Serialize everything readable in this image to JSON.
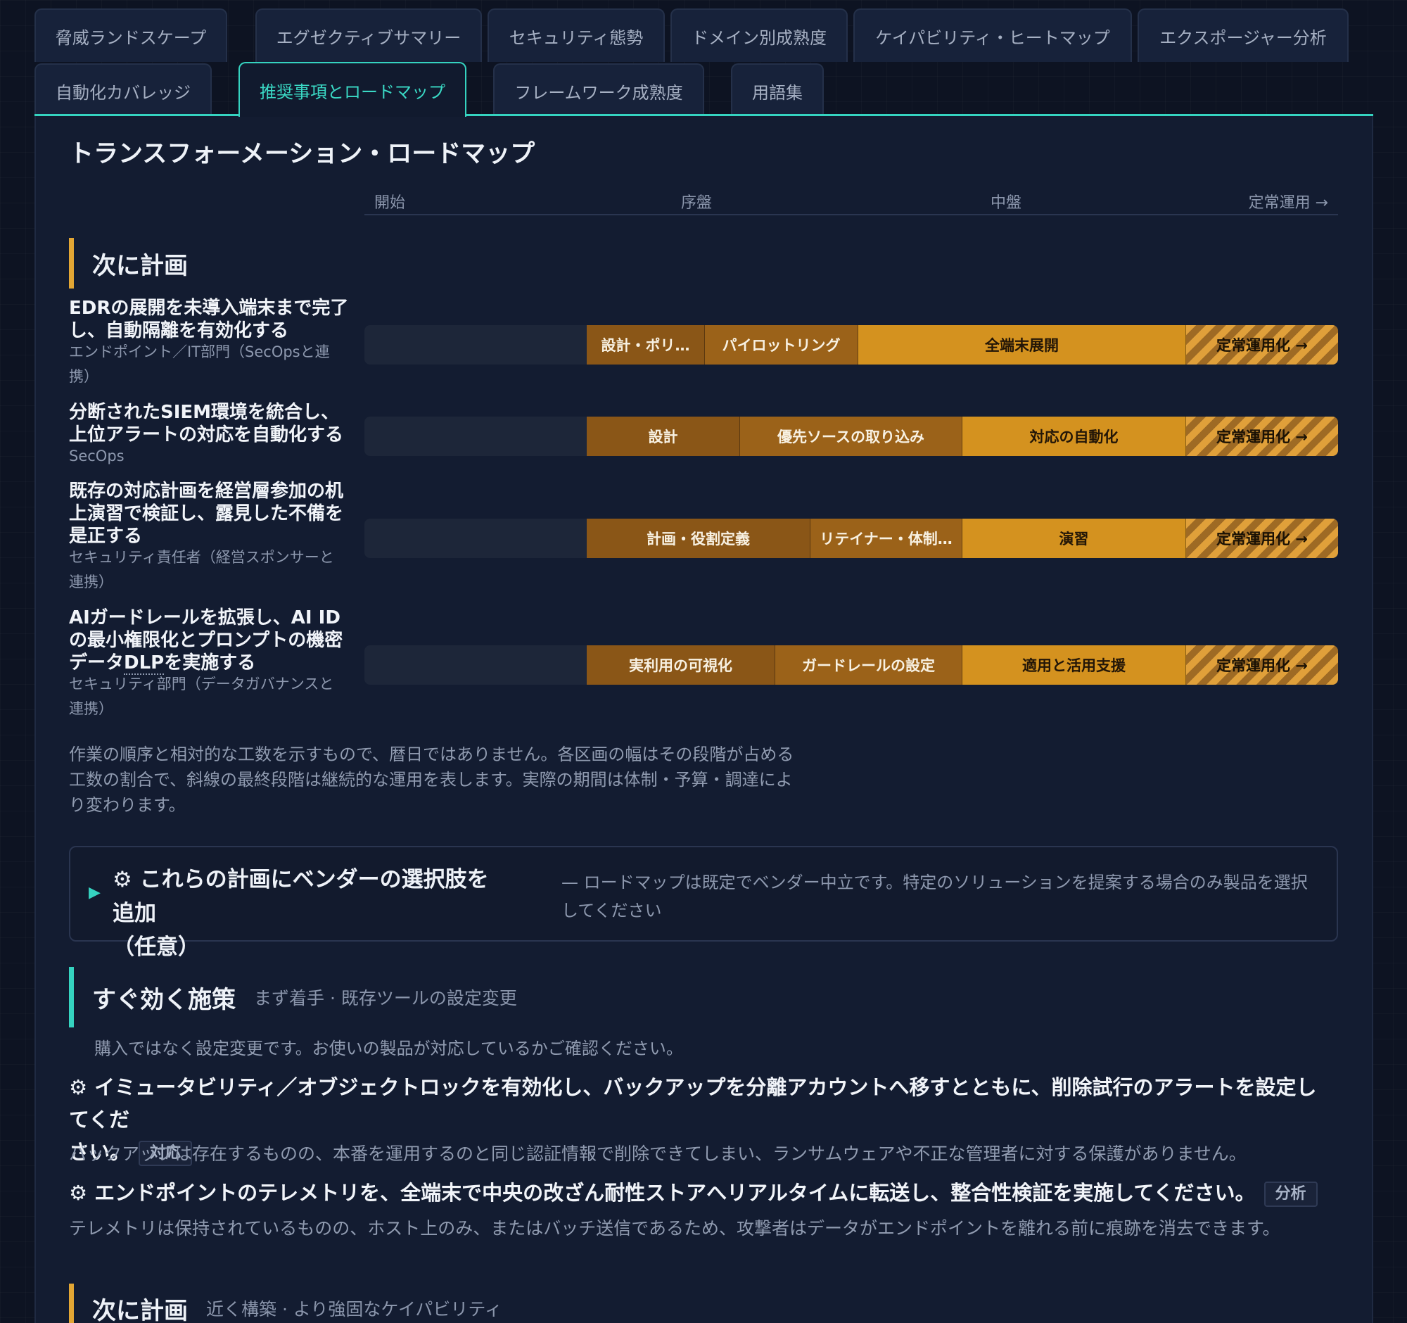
{
  "tabs_row1": [
    {
      "label": "脅威ランドスケープ"
    },
    {
      "label": "エグゼクティブサマリー"
    },
    {
      "label": "セキュリティ態勢"
    },
    {
      "label": "ドメイン別成熟度"
    },
    {
      "label": "ケイパビリティ・ヒートマップ"
    },
    {
      "label": "エクスポージャー分析"
    }
  ],
  "tabs_row2": [
    {
      "label": "自動化カバレッジ"
    },
    {
      "label": "推奨事項とロードマップ",
      "active": true
    },
    {
      "label": "フレームワーク成熟度"
    },
    {
      "label": "用語集"
    }
  ],
  "roadmap": {
    "title": "トランスフォーメーション・ロードマップ",
    "timeline": [
      "開始",
      "序盤",
      "中盤",
      "定常運用 →"
    ],
    "section_label": "次に計画",
    "rows": [
      {
        "title_lines": [
          "EDRの展開を未導入端末まで完了",
          "し、自動隔離を有効化する"
        ],
        "owner_lines": [
          "エンドポイント／IT部門（SecOpsと連",
          "携）"
        ],
        "phases": [
          "設計・ポリ…",
          "パイロットリング",
          "全端末展開",
          "定常運用化 →"
        ]
      },
      {
        "title_lines": [
          "分断されたSIEM環境を統合し、",
          "上位アラートの対応を自動化する"
        ],
        "owner_lines": [
          "SecOps"
        ],
        "phases": [
          "設計",
          "優先ソースの取り込み",
          "対応の自動化",
          "定常運用化 →"
        ]
      },
      {
        "title_lines": [
          "既存の対応計画を経営層参加の机",
          "上演習で検証し、露見した不備を",
          "是正する"
        ],
        "owner_lines": [
          "セキュリティ責任者（経営スポンサーと",
          "連携）"
        ],
        "phases": [
          "計画・役割定義",
          "リテイナー・体制…",
          "演習",
          "定常運用化 →"
        ]
      },
      {
        "title_lines": [
          "AIガードレールを拡張し、AI ID",
          "の最小権限化とプロンプトの機密",
          "データ",
          "DLP",
          "を実施する"
        ],
        "owner_lines": [
          "セキュリティ部門（データガバナンスと",
          "連携）"
        ],
        "phases": [
          "実利用の可視化",
          "ガードレールの設定",
          "適用と活用支援",
          "定常運用化 →"
        ]
      }
    ],
    "note_lines": [
      "作業の順序と相対的な工数を示すもので、暦日ではありません。各区画の幅はその段階が占める",
      "工数の割合で、斜線の最終段階は継続的な運用を表します。実際の期間は体制・予算・調達によ",
      "り変わります。"
    ]
  },
  "vendor": {
    "arrow": "▶",
    "title_lines": [
      "⚙ これらの計画にベンダーの選択肢を追加",
      "（任意）"
    ],
    "subtitle_lines": [
      "— ロードマップは既定でベンダー中立です。特定のソリューションを提案する場合のみ製品を選択",
      "してください"
    ]
  },
  "quick_wins": {
    "title": "すぐ効く施策",
    "subtitle": "まず着手 · 既存ツールの設定変更",
    "intro": "購入ではなく設定変更です。お使いの製品が対応しているかご確認ください。",
    "items": [
      {
        "gear": "⚙",
        "title_lines": [
          "イミュータビリティ／オブジェクトロックを有効化し、バックアップを分離アカウントへ移すとともに、削除試行のアラートを設定してくだ",
          "さい。"
        ],
        "tag": "対応",
        "desc": "バックアップは存在するものの、本番を運用するのと同じ認証情報で削除できてしまい、ランサムウェアや不正な管理者に対する保護がありません。"
      },
      {
        "gear": "⚙",
        "title_lines": [
          "エンドポイントのテレメトリを、全端末で中央の改ざん耐性ストアへリアルタイムに転送し、整合性検証を実施してください。"
        ],
        "tag": "分析",
        "desc": "テレメトリは保持されているものの、ホスト上のみ、またはバッチ送信であるため、攻撃者はデータがエンドポイントを離れる前に痕跡を消去できます。"
      }
    ]
  },
  "next_plan": {
    "title": "次に計画",
    "subtitle": "近く構築 · より強固なケイパビリティ"
  }
}
